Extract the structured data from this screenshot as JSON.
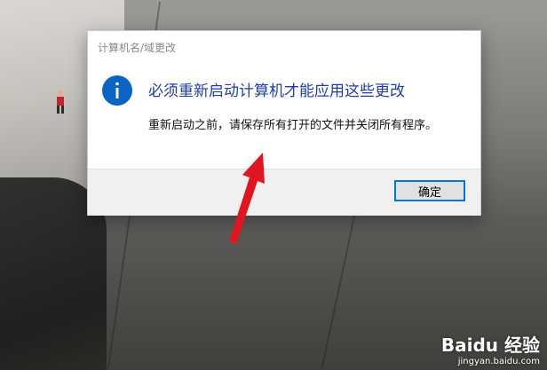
{
  "dialog": {
    "title": "计算机名/域更改",
    "icon": "info-icon",
    "main_instruction": "必须重新启动计算机才能应用这些更改",
    "content": "重新启动之前，请保存所有打开的文件并关闭所有程序。",
    "ok_button_label": "确定",
    "colors": {
      "instruction": "#1f3fa8",
      "icon": "#0b63c4",
      "button_border": "#0078d7",
      "arrow": "#e0151d"
    }
  },
  "watermark": {
    "brand": "Baidu 经验",
    "url": "jingyan.baidu.com"
  }
}
